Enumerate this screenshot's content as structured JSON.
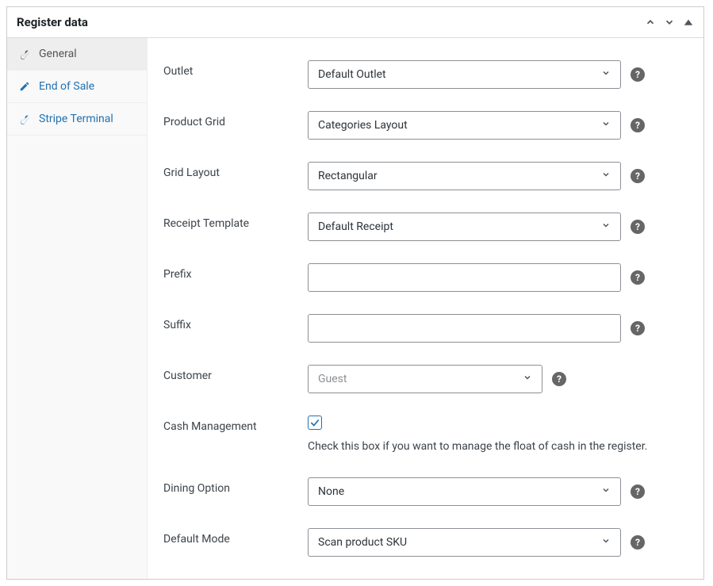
{
  "header": {
    "title": "Register data"
  },
  "sidebar": {
    "items": [
      {
        "label": "General",
        "icon": "wrench-icon",
        "active": true
      },
      {
        "label": "End of Sale",
        "icon": "edit-icon",
        "active": false
      },
      {
        "label": "Stripe Terminal",
        "icon": "wrench-icon",
        "active": false
      }
    ]
  },
  "fields": {
    "outlet": {
      "label": "Outlet",
      "value": "Default Outlet"
    },
    "product_grid": {
      "label": "Product Grid",
      "value": "Categories Layout"
    },
    "grid_layout": {
      "label": "Grid Layout",
      "value": "Rectangular"
    },
    "receipt_template": {
      "label": "Receipt Template",
      "value": "Default Receipt"
    },
    "prefix": {
      "label": "Prefix",
      "value": ""
    },
    "suffix": {
      "label": "Suffix",
      "value": ""
    },
    "customer": {
      "label": "Customer",
      "value": "Guest"
    },
    "cash_management": {
      "label": "Cash Management",
      "checked": true,
      "description": "Check this box if you want to manage the float of cash in the register."
    },
    "dining_option": {
      "label": "Dining Option",
      "value": "None"
    },
    "default_mode": {
      "label": "Default Mode",
      "value": "Scan product SKU"
    }
  }
}
